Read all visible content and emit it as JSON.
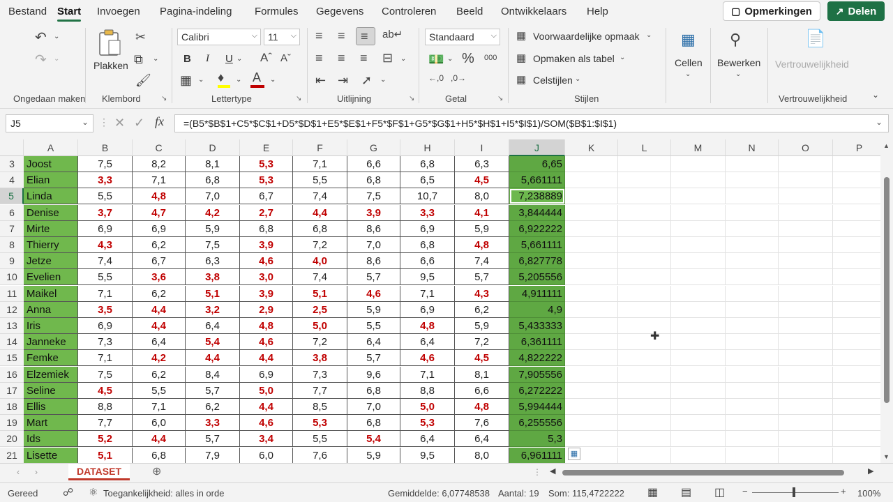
{
  "menu": {
    "tabs": [
      "Bestand",
      "Start",
      "Invoegen",
      "Pagina-indeling",
      "Formules",
      "Gegevens",
      "Controleren",
      "Beeld",
      "Ontwikkelaars",
      "Help"
    ],
    "comments_label": "Opmerkingen",
    "share_label": "Delen"
  },
  "ribbon": {
    "undo_group": "Ongedaan maken",
    "clipboard_group": "Klembord",
    "paste_label": "Plakken",
    "font_group": "Lettertype",
    "font_name": "Calibri",
    "font_size": "11",
    "bold": "B",
    "italic": "I",
    "underline": "U",
    "alignment_group": "Uitlijning",
    "number_group": "Getal",
    "number_format": "Standaard",
    "styles_group": "Stijlen",
    "conditional_formatting": "Voorwaardelijke opmaak",
    "format_as_table": "Opmaken als tabel",
    "cell_styles": "Celstijlen",
    "cells_label": "Cellen",
    "editing_label": "Bewerken",
    "sensitivity_label": "Vertrouwelijkheid",
    "sensitivity_group": "Vertrouwelijkheid"
  },
  "formula_bar": {
    "name_box": "J5",
    "formula": "=(B5*$B$1+C5*$C$1+D5*$D$1+E5*$E$1+F5*$F$1+G5*$G$1+H5*$H$1+I5*$I$1)/SOM($B$1:$I$1)"
  },
  "columns": [
    "A",
    "B",
    "C",
    "D",
    "E",
    "F",
    "G",
    "H",
    "I",
    "J",
    "K",
    "L",
    "M",
    "N",
    "O",
    "P"
  ],
  "rows": [
    {
      "n": "3",
      "name": "Joost",
      "v": [
        "7,5",
        "8,2",
        "8,1",
        "5,3",
        "7,1",
        "6,6",
        "6,8",
        "6,3"
      ],
      "low": [
        0,
        0,
        0,
        1,
        0,
        0,
        0,
        0
      ],
      "avg": "6,65"
    },
    {
      "n": "4",
      "name": "Elian",
      "v": [
        "3,3",
        "7,1",
        "6,8",
        "5,3",
        "5,5",
        "6,8",
        "6,5",
        "4,5"
      ],
      "low": [
        1,
        0,
        0,
        1,
        0,
        0,
        0,
        1
      ],
      "avg": "5,661111"
    },
    {
      "n": "5",
      "name": "Linda",
      "v": [
        "5,5",
        "4,8",
        "7,0",
        "6,7",
        "7,4",
        "7,5",
        "10,7",
        "8,0"
      ],
      "low": [
        0,
        1,
        0,
        0,
        0,
        0,
        0,
        0
      ],
      "avg": "7,238889"
    },
    {
      "n": "6",
      "name": "Denise",
      "v": [
        "3,7",
        "4,7",
        "4,2",
        "2,7",
        "4,4",
        "3,9",
        "3,3",
        "4,1"
      ],
      "low": [
        1,
        1,
        1,
        1,
        1,
        1,
        1,
        1
      ],
      "avg": "3,844444"
    },
    {
      "n": "7",
      "name": "Mirte",
      "v": [
        "6,9",
        "6,9",
        "5,9",
        "6,8",
        "6,8",
        "8,6",
        "6,9",
        "5,9"
      ],
      "low": [
        0,
        0,
        0,
        0,
        0,
        0,
        0,
        0
      ],
      "avg": "6,922222"
    },
    {
      "n": "8",
      "name": "Thierry",
      "v": [
        "4,3",
        "6,2",
        "7,5",
        "3,9",
        "7,2",
        "7,0",
        "6,8",
        "4,8"
      ],
      "low": [
        1,
        0,
        0,
        1,
        0,
        0,
        0,
        1
      ],
      "avg": "5,661111"
    },
    {
      "n": "9",
      "name": "Jetze",
      "v": [
        "7,4",
        "6,7",
        "6,3",
        "4,6",
        "4,0",
        "8,6",
        "6,6",
        "7,4"
      ],
      "low": [
        0,
        0,
        0,
        1,
        1,
        0,
        0,
        0
      ],
      "avg": "6,827778"
    },
    {
      "n": "10",
      "name": "Evelien",
      "v": [
        "5,5",
        "3,6",
        "3,8",
        "3,0",
        "7,4",
        "5,7",
        "9,5",
        "5,7"
      ],
      "low": [
        0,
        1,
        1,
        1,
        0,
        0,
        0,
        0
      ],
      "avg": "5,205556"
    },
    {
      "n": "11",
      "name": "Maikel",
      "v": [
        "7,1",
        "6,2",
        "5,1",
        "3,9",
        "5,1",
        "4,6",
        "7,1",
        "4,3"
      ],
      "low": [
        0,
        0,
        1,
        1,
        1,
        1,
        0,
        1
      ],
      "avg": "4,911111"
    },
    {
      "n": "12",
      "name": "Anna",
      "v": [
        "3,5",
        "4,4",
        "3,2",
        "2,9",
        "2,5",
        "5,9",
        "6,9",
        "6,2"
      ],
      "low": [
        1,
        1,
        1,
        1,
        1,
        0,
        0,
        0
      ],
      "avg": "4,9"
    },
    {
      "n": "13",
      "name": "Iris",
      "v": [
        "6,9",
        "4,4",
        "6,4",
        "4,8",
        "5,0",
        "5,5",
        "4,8",
        "5,9"
      ],
      "low": [
        0,
        1,
        0,
        1,
        1,
        0,
        1,
        0
      ],
      "avg": "5,433333"
    },
    {
      "n": "14",
      "name": "Janneke",
      "v": [
        "7,3",
        "6,4",
        "5,4",
        "4,6",
        "7,2",
        "6,4",
        "6,4",
        "7,2"
      ],
      "low": [
        0,
        0,
        1,
        1,
        0,
        0,
        0,
        0
      ],
      "avg": "6,361111"
    },
    {
      "n": "15",
      "name": "Femke",
      "v": [
        "7,1",
        "4,2",
        "4,4",
        "4,4",
        "3,8",
        "5,7",
        "4,6",
        "4,5"
      ],
      "low": [
        0,
        1,
        1,
        1,
        1,
        0,
        1,
        1
      ],
      "avg": "4,822222"
    },
    {
      "n": "16",
      "name": "Elzemiek",
      "v": [
        "7,5",
        "6,2",
        "8,4",
        "6,9",
        "7,3",
        "9,6",
        "7,1",
        "8,1"
      ],
      "low": [
        0,
        0,
        0,
        0,
        0,
        0,
        0,
        0
      ],
      "avg": "7,905556"
    },
    {
      "n": "17",
      "name": "Seline",
      "v": [
        "4,5",
        "5,5",
        "5,7",
        "5,0",
        "7,7",
        "6,8",
        "8,8",
        "6,6"
      ],
      "low": [
        1,
        0,
        0,
        1,
        0,
        0,
        0,
        0
      ],
      "avg": "6,272222"
    },
    {
      "n": "18",
      "name": "Ellis",
      "v": [
        "8,8",
        "7,1",
        "6,2",
        "4,4",
        "8,5",
        "7,0",
        "5,0",
        "4,8"
      ],
      "low": [
        0,
        0,
        0,
        1,
        0,
        0,
        1,
        1
      ],
      "avg": "5,994444"
    },
    {
      "n": "19",
      "name": "Mart",
      "v": [
        "7,7",
        "6,0",
        "3,3",
        "4,6",
        "5,3",
        "6,8",
        "5,3",
        "7,6"
      ],
      "low": [
        0,
        0,
        1,
        1,
        1,
        0,
        1,
        0
      ],
      "avg": "6,255556"
    },
    {
      "n": "20",
      "name": "Ids",
      "v": [
        "5,2",
        "4,4",
        "5,7",
        "3,4",
        "5,5",
        "5,4",
        "6,4",
        "6,4"
      ],
      "low": [
        1,
        1,
        0,
        1,
        0,
        1,
        0,
        0
      ],
      "avg": "5,3"
    },
    {
      "n": "21",
      "name": "Lisette",
      "v": [
        "5,1",
        "6,8",
        "7,9",
        "6,0",
        "7,6",
        "5,9",
        "9,5",
        "8,0"
      ],
      "low": [
        1,
        0,
        0,
        0,
        0,
        0,
        0,
        0
      ],
      "avg": "6,961111"
    }
  ],
  "active_row": "5",
  "sheet_tab": "DATASET",
  "status": {
    "ready": "Gereed",
    "accessibility": "Toegankelijkheid: alles in orde",
    "average": "Gemiddelde: 6,07748538",
    "count": "Aantal: 19",
    "sum": "Som: 115,4722222",
    "zoom": "100%"
  }
}
